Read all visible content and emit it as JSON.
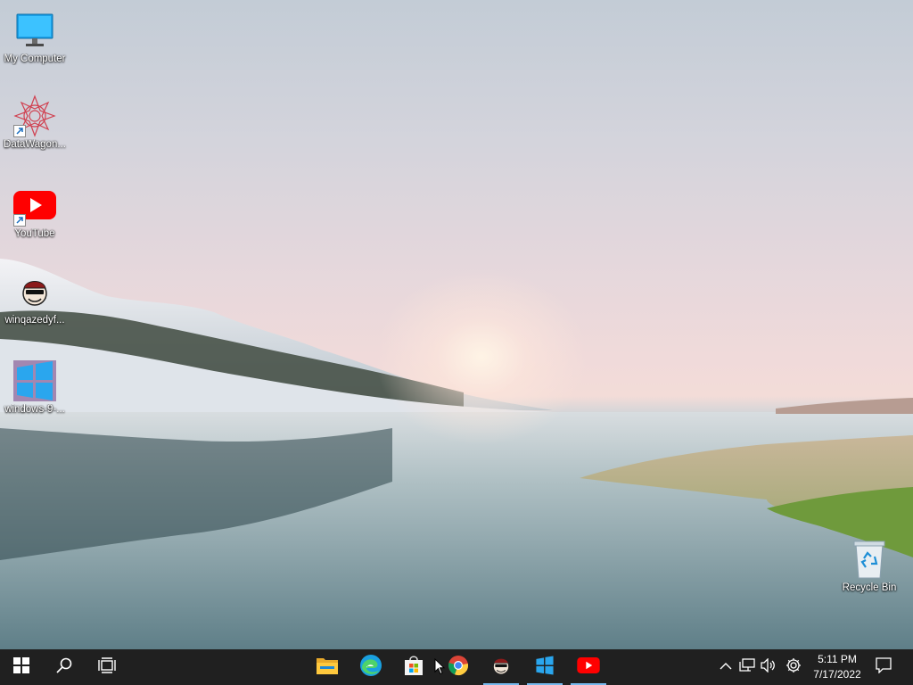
{
  "desktop": {
    "icons": [
      {
        "label": "My Computer",
        "icon": "computer-icon",
        "shortcut": false
      },
      {
        "label": "DataWagon...",
        "icon": "datawagon-icon",
        "shortcut": true
      },
      {
        "label": "YouTube",
        "icon": "youtube-icon",
        "shortcut": true
      },
      {
        "label": "winqazedyf...",
        "icon": "avatar-icon",
        "shortcut": false
      },
      {
        "label": "windows-9-...",
        "icon": "windows-logo-icon",
        "shortcut": false
      }
    ],
    "recycle_bin": {
      "label": "Recycle Bin",
      "icon": "recycle-bin-icon"
    }
  },
  "taskbar": {
    "start_icon": "windows-start-icon",
    "search_icon": "search-icon",
    "task_view_icon": "task-view-icon",
    "pinned": [
      {
        "name": "File Explorer",
        "icon": "folder-icon"
      },
      {
        "name": "Microsoft Edge",
        "icon": "edge-icon"
      },
      {
        "name": "Microsoft Store",
        "icon": "store-icon"
      },
      {
        "name": "Google Chrome",
        "icon": "chrome-icon"
      },
      {
        "name": "winqazedyf",
        "icon": "avatar-icon"
      },
      {
        "name": "windows-9",
        "icon": "windows-logo-icon"
      },
      {
        "name": "YouTube",
        "icon": "youtube-icon"
      }
    ],
    "tray": {
      "chevron_icon": "chevron-up-icon",
      "network_icon": "network-icon",
      "volume_icon": "volume-icon",
      "settings_icon": "gear-icon",
      "time": "5:11 PM",
      "date": "7/17/2022",
      "notification_icon": "notification-icon"
    }
  },
  "colors": {
    "taskbar_bg": "#202020",
    "active_indicator": "#76b9ed",
    "youtube_red": "#ff0000",
    "windows_blue": "#1e9be6"
  }
}
